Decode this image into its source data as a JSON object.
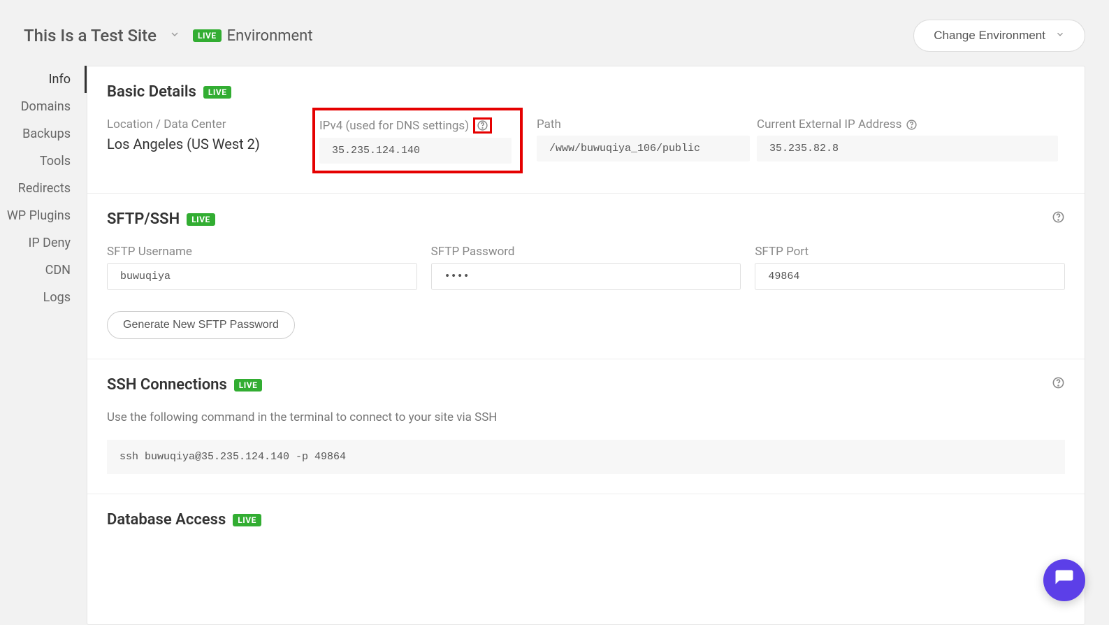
{
  "header": {
    "site_title": "This Is a Test Site",
    "live_badge": "LIVE",
    "environment_label": "Environment",
    "change_env_btn": "Change Environment"
  },
  "sidebar": {
    "items": [
      {
        "label": "Info",
        "name": "sidebar-item-info",
        "active": true
      },
      {
        "label": "Domains",
        "name": "sidebar-item-domains",
        "active": false
      },
      {
        "label": "Backups",
        "name": "sidebar-item-backups",
        "active": false
      },
      {
        "label": "Tools",
        "name": "sidebar-item-tools",
        "active": false
      },
      {
        "label": "Redirects",
        "name": "sidebar-item-redirects",
        "active": false
      },
      {
        "label": "WP Plugins",
        "name": "sidebar-item-wp-plugins",
        "active": false
      },
      {
        "label": "IP Deny",
        "name": "sidebar-item-ip-deny",
        "active": false
      },
      {
        "label": "CDN",
        "name": "sidebar-item-cdn",
        "active": false
      },
      {
        "label": "Logs",
        "name": "sidebar-item-logs",
        "active": false
      }
    ]
  },
  "basic_details": {
    "title": "Basic Details",
    "badge": "LIVE",
    "location_label": "Location / Data Center",
    "location_value": "Los Angeles (US West 2)",
    "ipv4_label": "IPv4 (used for DNS settings)",
    "ipv4_value": "35.235.124.140",
    "path_label": "Path",
    "path_value": "/www/buwuqiya_106/public",
    "ext_ip_label": "Current External IP Address",
    "ext_ip_value": "35.235.82.8"
  },
  "sftp": {
    "title": "SFTP/SSH",
    "badge": "LIVE",
    "username_label": "SFTP Username",
    "username_value": "buwuqiya",
    "password_label": "SFTP Password",
    "password_value": "••••",
    "port_label": "SFTP Port",
    "port_value": "49864",
    "generate_btn": "Generate New SFTP Password"
  },
  "ssh": {
    "title": "SSH Connections",
    "badge": "LIVE",
    "instructions": "Use the following command in the terminal to connect to your site via SSH",
    "command": "ssh buwuqiya@35.235.124.140 -p 49864"
  },
  "database": {
    "title": "Database Access",
    "badge": "LIVE"
  }
}
